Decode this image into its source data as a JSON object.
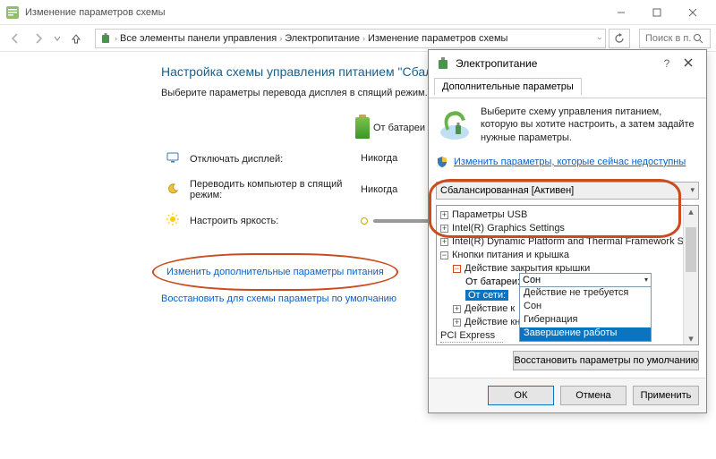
{
  "window": {
    "title": "Изменение параметров схемы"
  },
  "breadcrumb": {
    "part1": "Все элементы панели управления",
    "part2": "Электропитание",
    "part3": "Изменение параметров схемы",
    "search_placeholder": "Поиск в п..."
  },
  "main": {
    "heading": "Настройка схемы управления питанием \"Сбаланс",
    "subtitle": "Выберите параметры перевода дисплея в спящий режим.",
    "battery_header": "От батареи",
    "rows": {
      "display_off": {
        "label": "Отключать дисплей:",
        "battery_value": "Никогда"
      },
      "sleep": {
        "label": "Переводить компьютер в спящий режим:",
        "battery_value": "Никогда"
      },
      "brightness": {
        "label": "Настроить яркость:"
      }
    },
    "link_advanced": "Изменить дополнительные параметры питания",
    "link_restore": "Восстановить для схемы параметры по умолчанию"
  },
  "dialog": {
    "title": "Электропитание",
    "tab": "Дополнительные параметры",
    "scheme_hint": "Выберите схему управления питанием, которую вы хотите настроить, а затем задайте нужные параметры.",
    "shield_link": "Изменить параметры, которые сейчас недоступны",
    "scheme_combo": "Сбалансированная [Активен]",
    "tree": {
      "usb": "Параметры USB",
      "intel_gfx": "Intel(R) Graphics Settings",
      "intel_dptf": "Intel(R) Dynamic Platform and Thermal Framework Se",
      "lid": "Кнопки питания и крышка",
      "lid_action": "Действие закрытия крышки",
      "from_battery_lbl": "От батареи:",
      "from_battery_val": "Сон",
      "from_ac_lbl": "От сети:",
      "from_ac_val": "Сон",
      "action_k1": "Действие к",
      "action_k2": "Действие кн",
      "pci": "PCI Express"
    },
    "dropdown": {
      "current": "Сон",
      "opt0": "Действие не требуется",
      "opt1": "Сон",
      "opt2": "Гибернация",
      "opt3": "Завершение работы"
    },
    "restore_defaults": "Восстановить параметры по умолчанию",
    "ok": "ОК",
    "cancel": "Отмена",
    "apply": "Применить"
  }
}
